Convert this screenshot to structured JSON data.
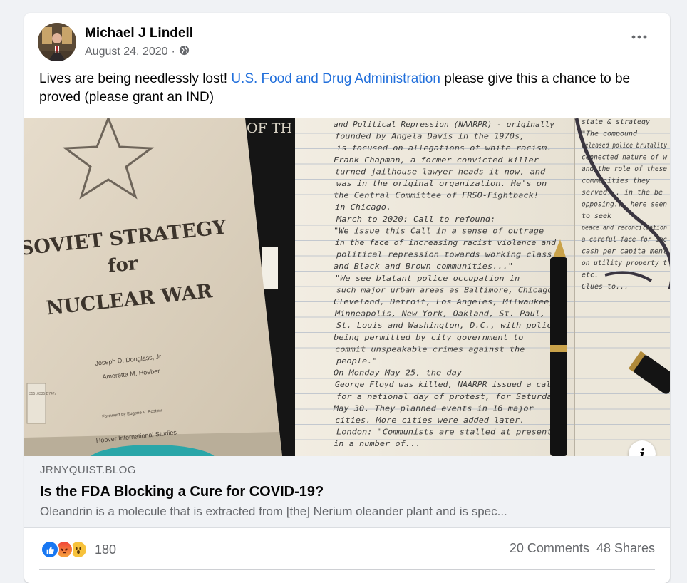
{
  "post": {
    "author": "Michael J Lindell",
    "date": "August 24, 2020",
    "separator": "·",
    "privacy_icon": "globe-icon",
    "text_before": "Lives are being needlessly lost! ",
    "text_link": "U.S. Food and Drug Administration",
    "text_after": " please give this a chance to be proved (please grant an IND)"
  },
  "image": {
    "book": {
      "title_line1": "SOVIET STRATEGY",
      "title_line2": "for",
      "title_line3": "NUCLEAR WAR",
      "author1": "Joseph D. Douglass, Jr.",
      "author2": "Amoretta M. Hoeber",
      "foreword": "Foreword by Eugene V. Rostow",
      "publisher": "Hoover International Studies",
      "library_tag": "355 .0335 D747s",
      "spine_text": "OF TH"
    },
    "notebook_lines": [
      "and Political Repression (NAARPR) - originally",
      "founded by Angela Davis in the 1970s,",
      "is focused on allegations of white racism.",
      "Frank Chapman, a former convicted killer",
      "turned jailhouse lawyer heads it now, and",
      "was in the original organization. He's on",
      "the Central Committee of FRSO-Fightback!",
      "in Chicago.",
      "March to 2020: Call to refound:",
      "\"We issue this Call in a sense of outrage",
      "in the face of increasing racist violence and",
      "political repression towards working class",
      "and Black and Brown communities...\"",
      "\"We see blatant police occupation in",
      "such major urban areas as Baltimore, Chicago,",
      "Cleveland, Detroit, Los Angeles, Milwaukee,",
      "Minneapolis, New York, Oakland, St. Paul,",
      "St. Louis and Washington, D.C., with police",
      "being permitted by city government to",
      "commit unspeakable crimes against the",
      "people.\"",
      "On Monday May 25, the day",
      "George Floyd was killed, NAARPR issued a call",
      "for a national day of protest, for Saturday",
      "May 30. They planned events in 16 major",
      "cities. More cities were added later.",
      "London: \"Communists are stalled at present",
      "in a number of..."
    ],
    "right_page_lines": [
      "state & strategy",
      "\"The compound",
      "released police brutality",
      "connected nature of w",
      "and the role of these",
      "communities they",
      "served... in the be",
      "opposing... here seen",
      "to seek",
      "peace and reconciliation",
      "a careful face for inc",
      "cash per capita ment",
      "on utility property t",
      "etc.",
      "Clues to..."
    ]
  },
  "info_button": {
    "label": "i",
    "icon": "info-icon"
  },
  "link_preview": {
    "domain": "JRNYQUIST.BLOG",
    "title": "Is the FDA Blocking a Cure for COVID-19?",
    "description": "Oleandrin is a molecule that is extracted from [the] Nerium oleander plant and is spec..."
  },
  "engagement": {
    "reaction_icons": [
      "like-icon",
      "angry-icon",
      "wow-icon"
    ],
    "reaction_count": "180",
    "comments": "20 Comments",
    "shares": "48 Shares"
  },
  "colors": {
    "link": "#216fdb",
    "secondary_text": "#65676b",
    "like_blue": "#1877f2",
    "card_bg": "#ffffff",
    "page_bg": "#f0f2f5"
  }
}
